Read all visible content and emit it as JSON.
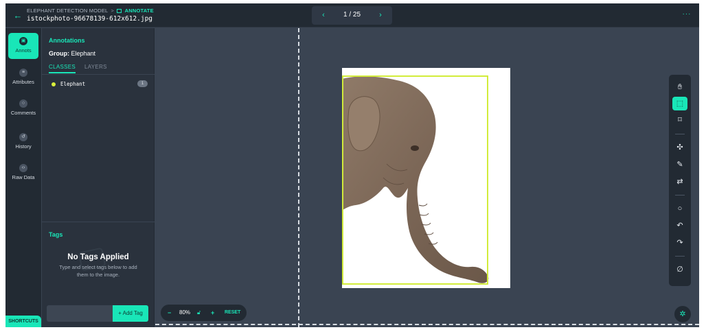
{
  "header": {
    "breadcrumb_project": "ELEPHANT DETECTION MODEL",
    "breadcrumb_separator": ">",
    "breadcrumb_current": "ANNOTATE",
    "filename": "istockphoto-96678139-612x612.jpg",
    "page_indicator": "1 / 25",
    "back_icon": "arrow-left-icon",
    "more_icon": "ellipsis-icon",
    "accent_color": "#19e6b8"
  },
  "rail": {
    "items": [
      {
        "label": "Annots",
        "icon": "annotations-icon",
        "active": true
      },
      {
        "label": "Attributes",
        "icon": "list-icon",
        "active": false
      },
      {
        "label": "Comments",
        "icon": "comment-icon",
        "active": false
      },
      {
        "label": "History",
        "icon": "history-icon",
        "active": false
      },
      {
        "label": "Raw Data",
        "icon": "code-icon",
        "active": false
      }
    ],
    "shortcuts_label": "SHORTCUTS"
  },
  "panel": {
    "title": "Annotations",
    "group_label": "Group:",
    "group_value": "Elephant",
    "tabs": [
      "CLASSES",
      "LAYERS"
    ],
    "classes": [
      {
        "name": "Elephant",
        "count": "1",
        "color": "#d9ef3b"
      }
    ]
  },
  "tags": {
    "title": "Tags",
    "empty_title": "No Tags Applied",
    "empty_subtitle": "Type and select tags below to add them to the image.",
    "input_placeholder": "",
    "add_label": "+ Add Tag"
  },
  "zoom": {
    "value": "80%",
    "minus": "−",
    "plus": "+",
    "reset_label": "RESET"
  },
  "image": {
    "subject": "elephant",
    "bbox_color": "#d2ec3a"
  },
  "tools": [
    "hand-icon",
    "bounding-box-icon",
    "polygon-icon",
    "magic-select-icon",
    "magic-wand-icon",
    "swap-icon",
    "comment-icon",
    "undo-icon",
    "redo-icon",
    "clear-icon"
  ]
}
